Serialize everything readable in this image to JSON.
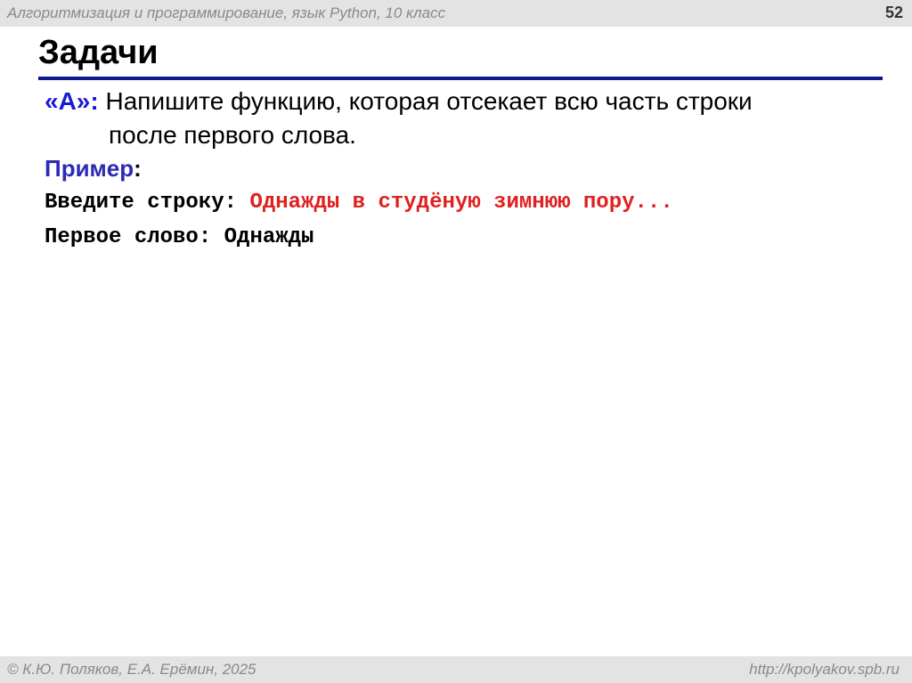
{
  "header": {
    "course_title": "Алгоритмизация и программирование, язык Python, 10 класс",
    "page_number": "52"
  },
  "slide": {
    "title": "Задачи",
    "task": {
      "label": "«A»:",
      "text_line1": "Напишите функцию, которая отсекает всю часть строки",
      "text_line2": "после первого слова."
    },
    "example": {
      "label": "Пример",
      "colon": ":",
      "lines": [
        {
          "prompt": "Введите строку: ",
          "input": "Однажды в студёную зимнюю пору..."
        },
        {
          "prompt": "Первое слово: ",
          "output": "Однажды"
        }
      ]
    }
  },
  "footer": {
    "authors": "© К.Ю. Поляков, Е.А. Ерёмин, 2025",
    "url": "http://kpolyakov.spb.ru"
  },
  "colors": {
    "rule": "#0d1a8c",
    "task_label": "#1a1ad6",
    "example_label": "#2b2bb5",
    "user_input": "#e02020",
    "bar_background": "#e3e3e3"
  }
}
